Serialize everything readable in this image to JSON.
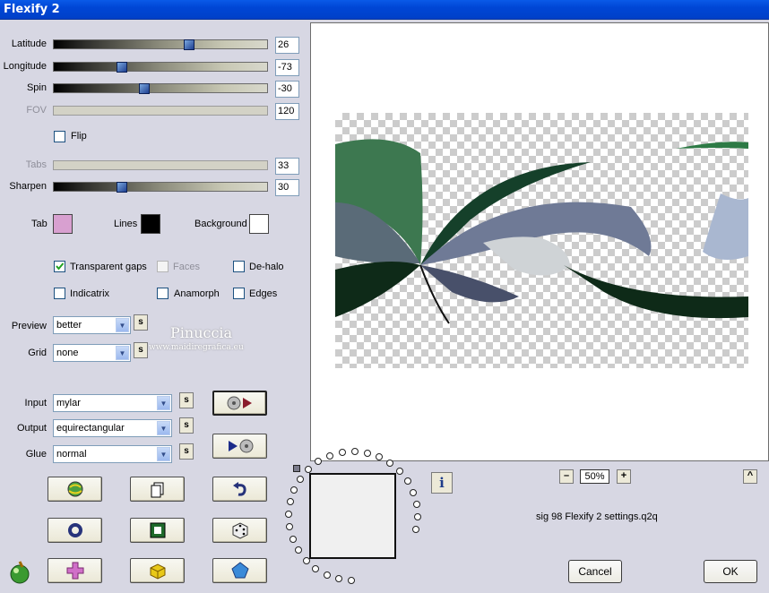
{
  "window": {
    "title": "Flexify 2"
  },
  "sliders": [
    {
      "label": "Latitude",
      "value": "26",
      "fraction": 0.64,
      "enabled": true
    },
    {
      "label": "Longitude",
      "value": "-73",
      "fraction": 0.31,
      "enabled": true
    },
    {
      "label": "Spin",
      "value": "-30",
      "fraction": 0.42,
      "enabled": true
    },
    {
      "label": "FOV",
      "value": "120",
      "fraction": null,
      "enabled": false
    },
    {
      "label": "Tabs",
      "value": "33",
      "fraction": null,
      "enabled": false
    },
    {
      "label": "Sharpen",
      "value": "30",
      "fraction": 0.31,
      "enabled": true
    }
  ],
  "flip": {
    "label": "Flip",
    "checked": false
  },
  "colors": {
    "tab": {
      "label": "Tab",
      "color": "#d8a0d0"
    },
    "lines": {
      "label": "Lines",
      "color": "#000000"
    },
    "background": {
      "label": "Background",
      "color": "#ffffff"
    }
  },
  "checkboxes": [
    {
      "label": "Transparent gaps",
      "checked": true,
      "enabled": true
    },
    {
      "label": "Faces",
      "checked": false,
      "enabled": false
    },
    {
      "label": "De-halo",
      "checked": false,
      "enabled": true
    },
    {
      "label": "Indicatrix",
      "checked": false,
      "enabled": true
    },
    {
      "label": "Anamorph",
      "checked": false,
      "enabled": true
    },
    {
      "label": "Edges",
      "checked": false,
      "enabled": true
    }
  ],
  "preview": {
    "label": "Preview",
    "value": "better",
    "s": "s"
  },
  "grid": {
    "label": "Grid",
    "value": "none",
    "s": "s"
  },
  "input": {
    "label": "Input",
    "value": "mylar",
    "s": "s"
  },
  "output": {
    "label": "Output",
    "value": "equirectangular",
    "s": "s"
  },
  "glue": {
    "label": "Glue",
    "value": "normal",
    "s": "s"
  },
  "watermark": {
    "name": "Pinuccia",
    "site": "www.maidiregrafica.eu"
  },
  "zoom": {
    "value": "50%",
    "minus": "–",
    "plus": "+"
  },
  "collapse": "^",
  "info": "i",
  "preset_file": "sig 98 Flexify 2 settings.q2q",
  "cancel": "Cancel",
  "ok": "OK"
}
